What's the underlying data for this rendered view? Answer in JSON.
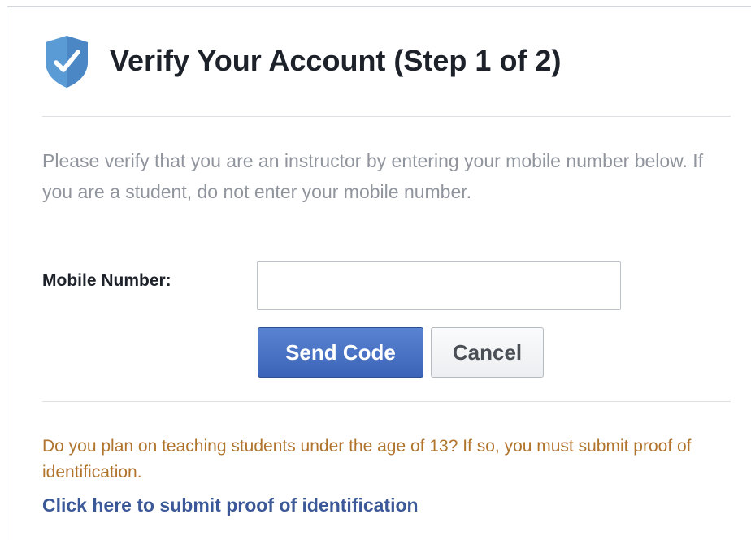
{
  "dialog": {
    "title": "Verify Your Account (Step 1 of 2)",
    "header_icon": "shield-check-icon",
    "intro_text": "Please verify that you are an instructor by entering your mobile number below. If you are a student, do not enter your mobile number.",
    "form": {
      "mobile_label": "Mobile Number:",
      "mobile_value": "",
      "mobile_placeholder": ""
    },
    "buttons": {
      "send_label": "Send Code",
      "cancel_label": "Cancel"
    },
    "warning_text": "Do you plan on teaching students under the age of 13? If so, you must submit proof of identification.",
    "proof_link_text": "Click here to submit proof of identification"
  },
  "colors": {
    "title": "#1d2129",
    "muted_text": "#90949c",
    "warning_text": "#b0742d",
    "link": "#3b5998",
    "primary_button": "#4a74c9",
    "shield": "#5b9bd5"
  }
}
